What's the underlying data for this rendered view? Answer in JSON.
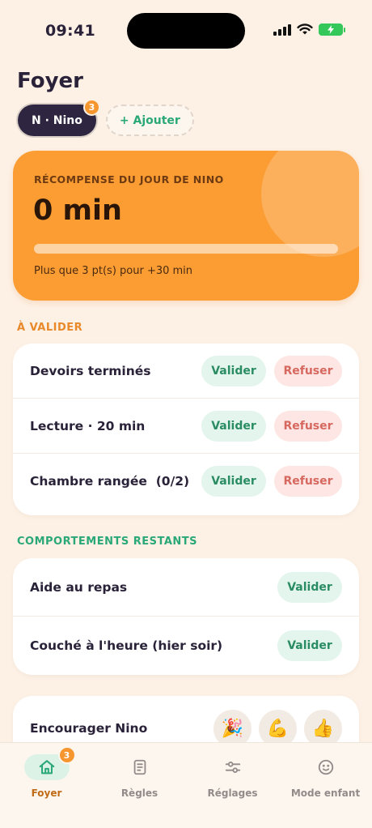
{
  "status_bar": {
    "time": "09:41"
  },
  "page": {
    "title": "Foyer"
  },
  "children": {
    "selected": {
      "label": "N · Nino",
      "badge": "3"
    },
    "add_label": "+ Ajouter"
  },
  "reward": {
    "label": "RÉCOMPENSE DU JOUR DE NINO",
    "value": "0 min",
    "progress": 0,
    "hint": "Plus que 3 pt(s) pour +30 min"
  },
  "pending": {
    "title": "À VALIDER",
    "items": [
      {
        "label": "Devoirs terminés",
        "ok": "Valider",
        "no": "Refuser"
      },
      {
        "label": "Lecture · 20 min",
        "ok": "Valider",
        "no": "Refuser"
      },
      {
        "label": "Chambre rangée  (0/2)",
        "ok": "Valider",
        "no": "Refuser"
      }
    ]
  },
  "remaining": {
    "title": "COMPORTEMENTS RESTANTS",
    "items": [
      {
        "label": "Aide au repas",
        "ok": "Valider"
      },
      {
        "label": "Couché à l'heure (hier soir)",
        "ok": "Valider"
      }
    ]
  },
  "encourage": {
    "label": "Encourager Nino",
    "emojis": [
      "🎉",
      "💪",
      "👍"
    ]
  },
  "tabs": [
    {
      "label": "Foyer",
      "icon": "home-icon",
      "badge": "3",
      "active": true
    },
    {
      "label": "Règles",
      "icon": "rules-icon"
    },
    {
      "label": "Réglages",
      "icon": "sliders-icon"
    },
    {
      "label": "Mode enfant",
      "icon": "smiley-icon"
    }
  ],
  "colors": {
    "background": "#fdf1e6",
    "accent_orange": "#fc9d34",
    "success_green": "#2aa877",
    "danger_red": "#d6685f",
    "dark": "#2a2238"
  }
}
